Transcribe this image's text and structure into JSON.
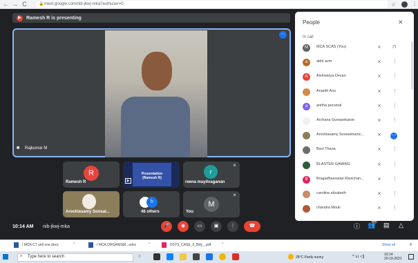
{
  "browser": {
    "url": "meet.google.com/nib-jkwj-mka?authuser=0",
    "nav_back": "←",
    "nav_forward": "→",
    "nav_reload": "C"
  },
  "meet": {
    "presenting_banner": "Ramesh R is presenting",
    "main_speaker_name": "Rajkumar M",
    "time": "10:14 AM",
    "meeting_code": "nib-jkwj-mka",
    "tiles": [
      {
        "name": "Ramesh R",
        "initial": "R",
        "color": "#e8453c"
      },
      {
        "name": "Presentation (Ramesh R)",
        "slide_text": "Presentation (Ramesh R)",
        "initial": "h"
      },
      {
        "name": "reena mayilvaganan",
        "initial": "r",
        "color": "#1e9e9b"
      },
      {
        "name": "Arockiasamy Soosai...",
        "initial": ""
      },
      {
        "name": "46 others",
        "initial": "h"
      },
      {
        "name": "You",
        "initial": "M",
        "color": "#5f6368"
      }
    ],
    "participants_badge": "49"
  },
  "people_panel": {
    "title": "People",
    "section": "In call",
    "participants": [
      {
        "name": "MCA SCAS (You)",
        "initial": "M",
        "color": "#5f6368",
        "action": "pin"
      },
      {
        "name": "abhi avm",
        "initial": "a",
        "color": "#b46c2b",
        "action": "more"
      },
      {
        "name": "Aishwarya Devan",
        "initial": "A",
        "color": "#e8453c",
        "action": "more"
      },
      {
        "name": "Ananth Ans",
        "initial": "",
        "color": "#d08b4a",
        "action": "more"
      },
      {
        "name": "anitha perumal",
        "initial": "a",
        "color": "#7b68ee",
        "action": "more"
      },
      {
        "name": "Archana Gunasekaran",
        "initial": "",
        "color": "#f0f0f0",
        "action": "more"
      },
      {
        "name": "Arockiasamy Soosaimanic...",
        "initial": "",
        "color": "#8c7d5b",
        "action": "more-blue"
      },
      {
        "name": "Bavi Thana",
        "initial": "",
        "color": "#6d6d6d",
        "action": "more"
      },
      {
        "name": "BLASTER GAMING",
        "initial": "",
        "color": "#2f5d3a",
        "action": "more"
      },
      {
        "name": "Bragadheeswari Ravichan...",
        "initial": "B",
        "color": "#e0245e",
        "action": "more"
      },
      {
        "name": "caroline.elizabeth",
        "initial": "",
        "color": "#c98d6a",
        "action": "more"
      },
      {
        "name": "chandra Mouli",
        "initial": "",
        "color": "#b05a3b",
        "action": "more"
      }
    ]
  },
  "downloads": {
    "items": [
      "I MCA CT unit one.docx",
      "I MCA ORGANISM...udoc",
      "DSTS_CASE_5_Bdy_..pdf"
    ],
    "show_all": "Show all"
  },
  "taskbar": {
    "search_placeholder": "Type here to search",
    "weather": "28°C Partly sunny",
    "clock_time": "10:14",
    "clock_date": "20-10-2021"
  }
}
